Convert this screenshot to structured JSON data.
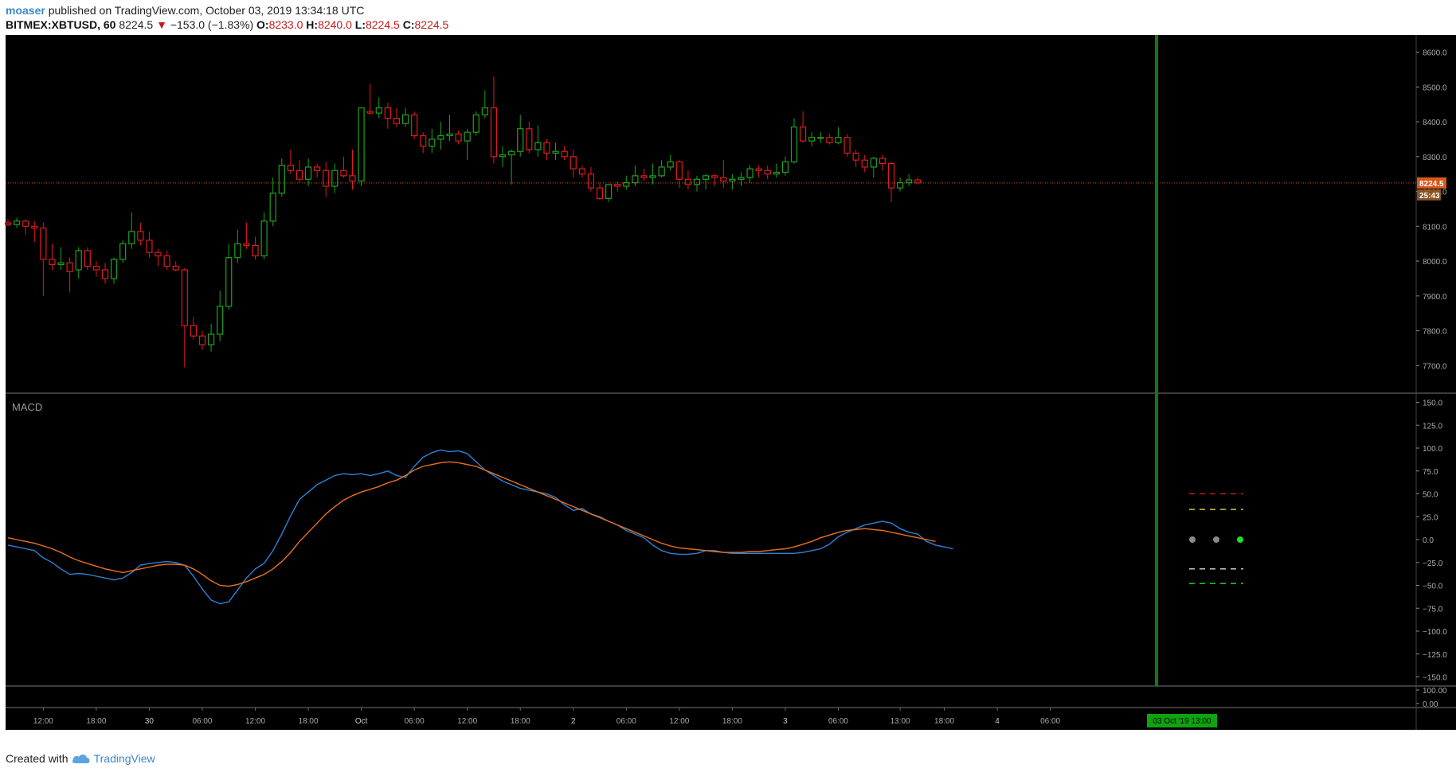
{
  "header": {
    "author": "moaser",
    "published_text": "published on TradingView.com, October 03, 2019 13:34:18 UTC",
    "symbol": "BITMEX:XBTUSD, 60",
    "last": "8224.5",
    "change_arrow": "▼",
    "change": "−153.0 (−1.83%)",
    "o_label": "O:",
    "o_value": "8233.0",
    "h_label": "H:",
    "h_value": "8240.0",
    "l_label": "L:",
    "l_value": "8224.5",
    "c_label": "C:",
    "c_value": "8224.5"
  },
  "footer": {
    "created_with": "Created with",
    "brand": "TradingView",
    "logo_icon": "tradingview-cloud-icon"
  },
  "colors": {
    "background": "#000000",
    "up": "#1fa31f",
    "down": "#e01c1c",
    "macd_line": "#2e82d6",
    "signal_line": "#e8711c",
    "cursor_line": "#0f7a0f",
    "price_label": "#d7581c",
    "countdown_label": "#8a5320",
    "time_label_bg": "#0fa30f"
  },
  "chart_data": [
    {
      "type": "candlestick",
      "ylim": [
        7630,
        8640
      ],
      "y_ticks": [
        "8600.0",
        "8500.0",
        "8400.0",
        "8300.0",
        "8200.0",
        "8100.0",
        "8000.0",
        "7900.0",
        "7800.0",
        "7700.0"
      ],
      "y_tick_values": [
        8600,
        8500,
        8400,
        8300,
        8200,
        8100,
        8000,
        7900,
        7800,
        7700
      ],
      "last_price_label": "8224.5",
      "countdown_label": "25:43",
      "x_ticks": [
        "12:00",
        "18:00",
        "30",
        "06:00",
        "12:00",
        "18:00",
        "Oct",
        "06:00",
        "12:00",
        "18:00",
        "2",
        "06:00",
        "12:00",
        "18:00",
        "3",
        "06:00",
        "13:00",
        "18:00",
        "4",
        "06:00"
      ],
      "x_tick_index": [
        4,
        10,
        16,
        22,
        28,
        34,
        40,
        46,
        52,
        58,
        64,
        70,
        76,
        82,
        88,
        94,
        101,
        106,
        112,
        118
      ],
      "current_time_label": "03 Oct '19   13:00",
      "candles": [
        [
          8110,
          8120,
          8100,
          8105
        ],
        [
          8105,
          8125,
          8095,
          8115
        ],
        [
          8115,
          8120,
          8075,
          8100
        ],
        [
          8100,
          8115,
          8055,
          8095
        ],
        [
          8095,
          8110,
          7900,
          8005
        ],
        [
          8005,
          8050,
          7975,
          7990
        ],
        [
          7990,
          8040,
          7975,
          7995
        ],
        [
          7995,
          8010,
          7910,
          7970
        ],
        [
          7975,
          8040,
          7950,
          8030
        ],
        [
          8030,
          8040,
          7975,
          7985
        ],
        [
          7985,
          8000,
          7955,
          7975
        ],
        [
          7975,
          7995,
          7935,
          7950
        ],
        [
          7950,
          8010,
          7935,
          8005
        ],
        [
          8005,
          8060,
          7995,
          8050
        ],
        [
          8050,
          8140,
          8035,
          8085
        ],
        [
          8085,
          8110,
          8045,
          8060
        ],
        [
          8060,
          8085,
          8010,
          8025
        ],
        [
          8025,
          8035,
          7985,
          8015
        ],
        [
          8015,
          8030,
          7975,
          7985
        ],
        [
          7985,
          8000,
          7970,
          7975
        ],
        [
          7975,
          7980,
          7695,
          7815
        ],
        [
          7815,
          7840,
          7775,
          7785
        ],
        [
          7785,
          7800,
          7745,
          7760
        ],
        [
          7760,
          7820,
          7740,
          7790
        ],
        [
          7790,
          7915,
          7770,
          7870
        ],
        [
          7870,
          8050,
          7860,
          8010
        ],
        [
          8010,
          8090,
          7995,
          8050
        ],
        [
          8050,
          8110,
          8035,
          8045
        ],
        [
          8045,
          8070,
          8005,
          8015
        ],
        [
          8015,
          8140,
          8005,
          8115
        ],
        [
          8115,
          8240,
          8100,
          8195
        ],
        [
          8195,
          8295,
          8185,
          8275
        ],
        [
          8275,
          8320,
          8250,
          8260
        ],
        [
          8260,
          8290,
          8225,
          8235
        ],
        [
          8235,
          8295,
          8215,
          8270
        ],
        [
          8270,
          8280,
          8240,
          8260
        ],
        [
          8260,
          8285,
          8185,
          8215
        ],
        [
          8215,
          8280,
          8195,
          8260
        ],
        [
          8260,
          8300,
          8240,
          8245
        ],
        [
          8245,
          8320,
          8205,
          8230
        ],
        [
          8230,
          8325,
          8215,
          8440
        ],
        [
          8430,
          8510,
          8420,
          8425
        ],
        [
          8425,
          8470,
          8410,
          8440
        ],
        [
          8440,
          8455,
          8380,
          8410
        ],
        [
          8410,
          8440,
          8385,
          8395
        ],
        [
          8395,
          8440,
          8385,
          8420
        ],
        [
          8420,
          8430,
          8350,
          8360
        ],
        [
          8360,
          8370,
          8310,
          8330
        ],
        [
          8330,
          8380,
          8310,
          8350
        ],
        [
          8350,
          8400,
          8320,
          8360
        ],
        [
          8360,
          8420,
          8345,
          8365
        ],
        [
          8365,
          8375,
          8335,
          8345
        ],
        [
          8345,
          8380,
          8290,
          8370
        ],
        [
          8370,
          8430,
          8360,
          8420
        ],
        [
          8420,
          8490,
          8410,
          8440
        ],
        [
          8440,
          8530,
          8280,
          8300
        ],
        [
          8300,
          8330,
          8270,
          8305
        ],
        [
          8305,
          8320,
          8220,
          8315
        ],
        [
          8315,
          8420,
          8300,
          8380
        ],
        [
          8380,
          8400,
          8310,
          8320
        ],
        [
          8320,
          8390,
          8300,
          8340
        ],
        [
          8340,
          8350,
          8290,
          8310
        ],
        [
          8310,
          8340,
          8290,
          8315
        ],
        [
          8315,
          8330,
          8290,
          8300
        ],
        [
          8300,
          8320,
          8240,
          8265
        ],
        [
          8265,
          8275,
          8240,
          8250
        ],
        [
          8250,
          8270,
          8200,
          8210
        ],
        [
          8210,
          8225,
          8175,
          8180
        ],
        [
          8180,
          8215,
          8170,
          8220
        ],
        [
          8220,
          8230,
          8200,
          8215
        ],
        [
          8215,
          8245,
          8205,
          8225
        ],
        [
          8225,
          8275,
          8215,
          8245
        ],
        [
          8245,
          8265,
          8230,
          8240
        ],
        [
          8240,
          8280,
          8220,
          8245
        ],
        [
          8245,
          8290,
          8240,
          8270
        ],
        [
          8270,
          8305,
          8260,
          8285
        ],
        [
          8285,
          8290,
          8210,
          8235
        ],
        [
          8235,
          8260,
          8205,
          8220
        ],
        [
          8220,
          8245,
          8200,
          8235
        ],
        [
          8235,
          8250,
          8205,
          8245
        ],
        [
          8245,
          8250,
          8215,
          8240
        ],
        [
          8240,
          8290,
          8210,
          8230
        ],
        [
          8230,
          8250,
          8205,
          8235
        ],
        [
          8235,
          8255,
          8215,
          8240
        ],
        [
          8240,
          8275,
          8225,
          8265
        ],
        [
          8265,
          8275,
          8240,
          8260
        ],
        [
          8260,
          8275,
          8235,
          8250
        ],
        [
          8250,
          8280,
          8240,
          8255
        ],
        [
          8255,
          8300,
          8245,
          8285
        ],
        [
          8285,
          8410,
          8280,
          8385
        ],
        [
          8385,
          8430,
          8340,
          8345
        ],
        [
          8345,
          8370,
          8330,
          8355
        ],
        [
          8355,
          8370,
          8340,
          8355
        ],
        [
          8355,
          8365,
          8335,
          8340
        ],
        [
          8340,
          8385,
          8335,
          8355
        ],
        [
          8355,
          8365,
          8300,
          8310
        ],
        [
          8310,
          8320,
          8270,
          8290
        ],
        [
          8290,
          8305,
          8255,
          8270
        ],
        [
          8270,
          8300,
          8240,
          8295
        ],
        [
          8295,
          8305,
          8260,
          8280
        ],
        [
          8280,
          8285,
          8170,
          8210
        ],
        [
          8210,
          8240,
          8200,
          8225
        ],
        [
          8225,
          8250,
          8215,
          8233
        ],
        [
          8233,
          8240,
          8224.5,
          8224.5
        ]
      ]
    },
    {
      "type": "line",
      "title": "MACD",
      "ylim": [
        -160,
        160
      ],
      "y_ticks": [
        "150.0",
        "125.0",
        "100.0",
        "75.0",
        "50.0",
        "25.0",
        "0.0",
        "−25.0",
        "−50.0",
        "−75.0",
        "−100.0",
        "−125.0",
        "−150.0"
      ],
      "y_tick_values": [
        150,
        125,
        100,
        75,
        50,
        25,
        0,
        -25,
        -50,
        -75,
        -100,
        -125,
        -150
      ],
      "series": [
        {
          "color": "#2e82d6",
          "values": [
            -6,
            -8,
            -10,
            -12,
            -20,
            -25,
            -32,
            -38,
            -37,
            -38,
            -40,
            -42,
            -44,
            -42,
            -36,
            -28,
            -26,
            -25,
            -24,
            -25,
            -28,
            -40,
            -54,
            -66,
            -70,
            -68,
            -55,
            -42,
            -32,
            -26,
            -12,
            6,
            26,
            44,
            52,
            60,
            65,
            70,
            72,
            71,
            72,
            70,
            72,
            75,
            70,
            68,
            80,
            90,
            95,
            98,
            96,
            97,
            94,
            85,
            76,
            70,
            64,
            60,
            56,
            54,
            52,
            50,
            46,
            38,
            32,
            34,
            28,
            25,
            20,
            16,
            10,
            6,
            2,
            -6,
            -12,
            -15,
            -16,
            -16,
            -15,
            -12,
            -12,
            -14,
            -15,
            -15,
            -15,
            -15,
            -15,
            -15,
            -15,
            -15,
            -14,
            -12,
            -10,
            -5,
            3,
            8,
            12,
            16,
            18,
            20,
            18,
            12,
            8,
            6,
            -2,
            -6,
            -8,
            -10
          ]
        },
        {
          "color": "#e8711c",
          "values": [
            2,
            0,
            -2,
            -4,
            -7,
            -10,
            -14,
            -19,
            -23,
            -26,
            -29,
            -32,
            -34,
            -36,
            -34,
            -32,
            -30,
            -28,
            -27,
            -27,
            -28,
            -32,
            -38,
            -45,
            -50,
            -51,
            -49,
            -46,
            -42,
            -38,
            -32,
            -24,
            -14,
            -2,
            8,
            18,
            28,
            36,
            43,
            48,
            52,
            55,
            58,
            62,
            65,
            70,
            76,
            80,
            82,
            84,
            85,
            84,
            82,
            80,
            76,
            72,
            68,
            64,
            60,
            56,
            52,
            48,
            44,
            40,
            36,
            32,
            28,
            24,
            20,
            16,
            12,
            8,
            4,
            0,
            -4,
            -7,
            -9,
            -10,
            -11,
            -12,
            -13,
            -14,
            -14,
            -14,
            -13,
            -13,
            -12,
            -11,
            -10,
            -8,
            -5,
            -2,
            2,
            5,
            8,
            10,
            11,
            12,
            11,
            10,
            8,
            6,
            4,
            2,
            0,
            -2
          ]
        }
      ],
      "signal_dots": [
        {
          "color": "#8a8a8a"
        },
        {
          "color": "#8a8a8a"
        },
        {
          "color": "#22e022"
        }
      ],
      "dashed_levels": [
        {
          "value": 50,
          "color": "#e01c1c"
        },
        {
          "value": 33,
          "color": "#e8d84a"
        },
        {
          "value": -32,
          "color": "#d8d8d8"
        },
        {
          "value": -48,
          "color": "#22e022"
        }
      ]
    },
    {
      "type": "line",
      "title": "",
      "y_ticks": [
        "100.00",
        "0.00"
      ],
      "y_tick_values": [
        100,
        0
      ]
    }
  ]
}
